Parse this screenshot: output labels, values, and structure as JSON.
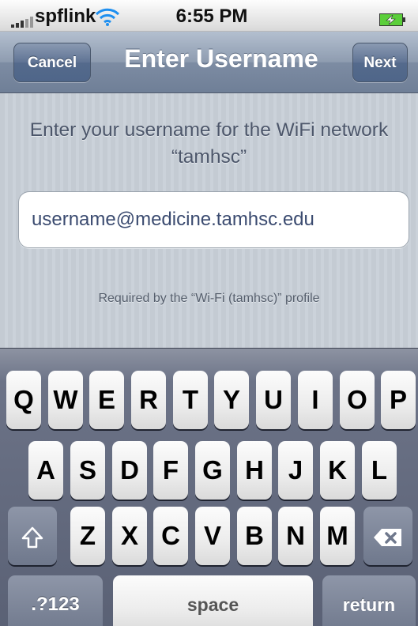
{
  "status_bar": {
    "carrier": "spflink",
    "time": "6:55 PM",
    "signal_icon": "signal-bars-icon",
    "wifi_icon": "wifi-icon",
    "battery_icon": "battery-charging-icon"
  },
  "nav": {
    "cancel_label": "Cancel",
    "title": "Enter Username",
    "next_label": "Next"
  },
  "content": {
    "instruction": "Enter your username for the WiFi network “tamhsc”",
    "username_value": "username@medicine.tamhsc.edu",
    "note": "Required by the “Wi-Fi (tamhsc)” profile"
  },
  "keyboard": {
    "row1": [
      "Q",
      "W",
      "E",
      "R",
      "T",
      "Y",
      "U",
      "I",
      "O",
      "P"
    ],
    "row2": [
      "A",
      "S",
      "D",
      "F",
      "G",
      "H",
      "J",
      "K",
      "L"
    ],
    "row3": [
      "Z",
      "X",
      "C",
      "V",
      "B",
      "N",
      "M"
    ],
    "numbers_label": ".?123",
    "space_label": "space",
    "return_label": "return",
    "shift_icon": "shift-icon",
    "backspace_icon": "backspace-icon"
  },
  "colors": {
    "nav_bar": "#7d8ca3",
    "content_bg": "#c5ccd4",
    "keyboard_bg": "#6c7387",
    "field_text": "#3b4b70"
  }
}
